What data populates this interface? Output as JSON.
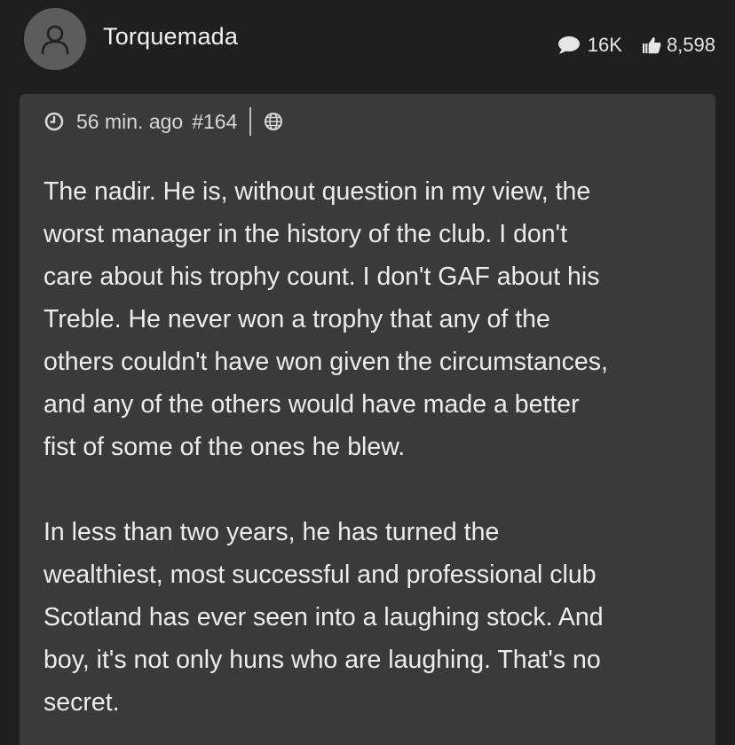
{
  "post": {
    "author": "Torquemada",
    "stats": {
      "comments": "16K",
      "likes": "8,598"
    },
    "meta": {
      "time": "56 min. ago",
      "post_number": "#164"
    },
    "paragraphs": [
      "The nadir. He is, without question in my view, the\nworst manager in the history of the club. I don't\ncare about his trophy count. I don't GAF about his\nTreble. He never won a trophy that any of the\nothers couldn't have won given the circumstances,\nand any of the others would have made a better\nfist of some of the ones he blew.",
      "In less than two years, he has turned the\nwealthiest, most successful and professional club\nScotland has ever seen into a laughing stock. And\nboy, it's not only huns who are laughing. That's no\nsecret."
    ]
  },
  "icons": {
    "avatar": "user-outline-icon",
    "comments": "speech-bubble-icon",
    "likes": "thumbs-up-icon",
    "time": "clock-icon",
    "visibility": "globe-icon"
  },
  "colors": {
    "background": "#1f1f1f",
    "card": "#3a3a3a",
    "avatar": "#5c5c5c",
    "text": "#ececec"
  }
}
